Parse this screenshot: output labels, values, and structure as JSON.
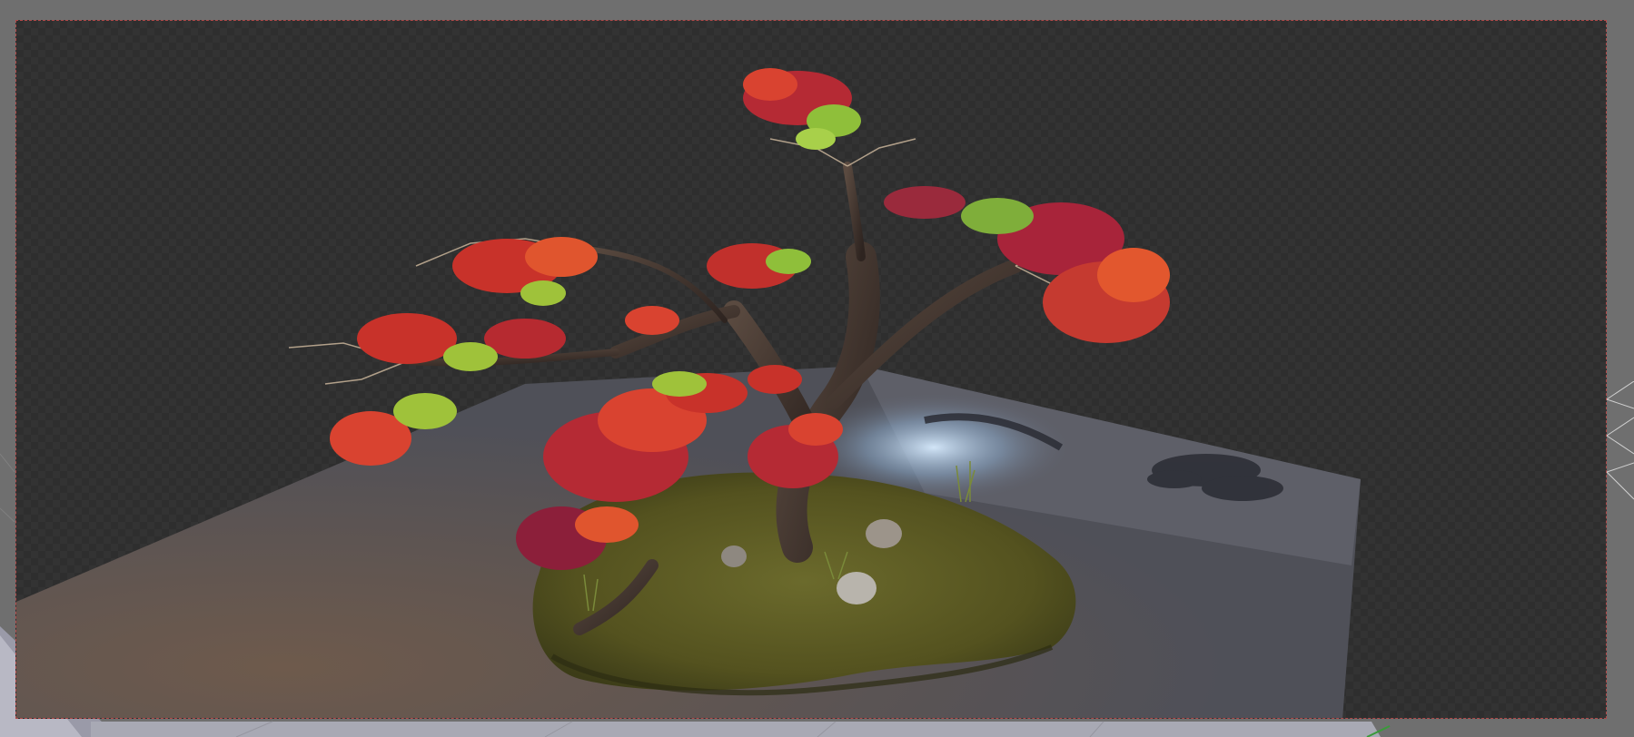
{
  "viewport": {
    "mode": "camera-render-preview",
    "background_color": "#6f6f6f",
    "checker_color_a": "#2e2e2e",
    "checker_color_b": "#333333",
    "frame_border_color": "#b04848"
  },
  "scene": {
    "subject": "bonsai-tree",
    "foliage_colors": [
      "#c8322a",
      "#e0552e",
      "#8c1f3a",
      "#9fc23a",
      "#6a9a2a"
    ],
    "trunk_color": "#4a3a30",
    "moss_color": "#5a5a24",
    "ground_plane_color": "#5f6068",
    "light_color": "#cfe6ff"
  }
}
